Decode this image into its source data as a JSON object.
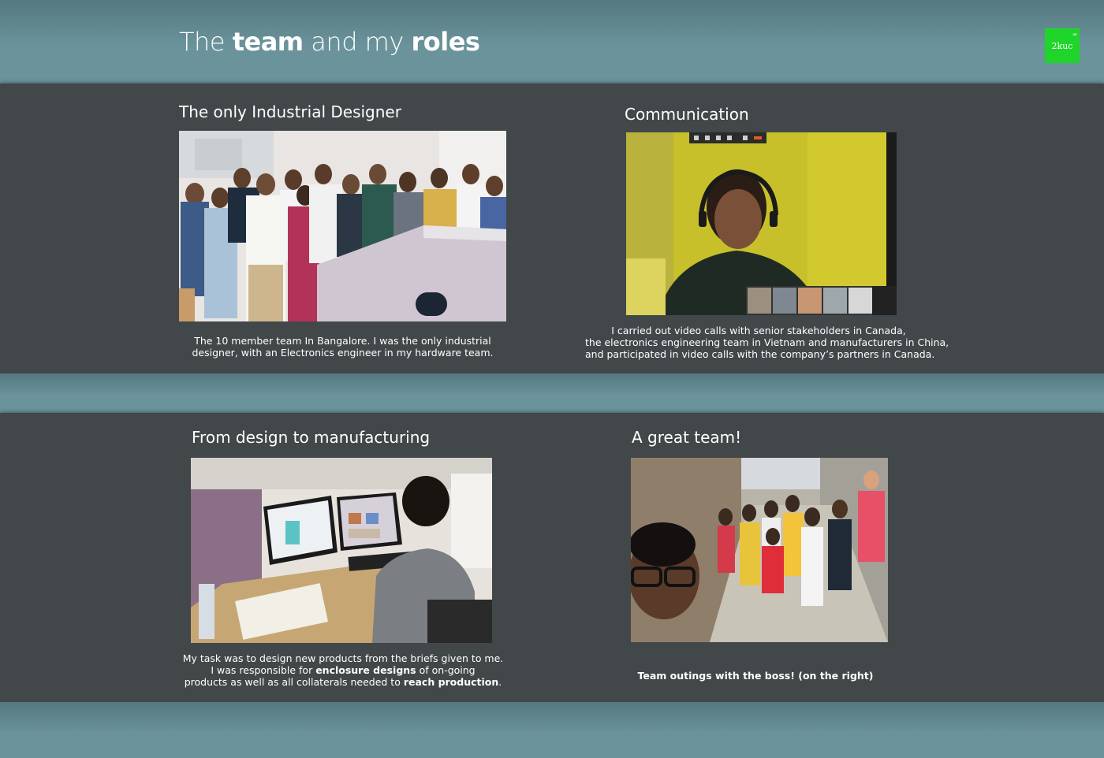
{
  "header": {
    "title_part1": "The ",
    "title_bold1": "team",
    "title_part2": " and my ",
    "title_bold2": "roles",
    "logo_text": "2kuc",
    "logo_dots": "°°",
    "logo_color": "#1fd52a"
  },
  "sections": [
    {
      "title": "The only Industrial Designer",
      "caption_lines": [
        "The 10 member team In Bangalore. I was the only industrial",
        "designer, with an Electronics engineer in my hardware team."
      ]
    },
    {
      "title": "Communication",
      "caption_lines": [
        "I carried out video calls with senior stakeholders in Canada,",
        "the electronics engineering team in Vietnam and manufacturers in China,",
        "and participated in video calls with the company’s partners in Canada."
      ]
    },
    {
      "title": "From design to manufacturing",
      "caption_line1": "My task was to design new products from the briefs given to me.",
      "caption_line2_a": "I was responsible for ",
      "caption_line2_bold": "enclosure designs",
      "caption_line2_b": " of on-going",
      "caption_line3_a": "products as well as all collaterals needed to ",
      "caption_line3_bold": "reach production",
      "caption_line3_b": "."
    },
    {
      "title": "A great team!",
      "caption": "Team outings with the boss! (on the right)"
    }
  ],
  "colors": {
    "teal_band": "#6b939c",
    "dark_panel": "#42474a",
    "text": "#ffffff"
  }
}
